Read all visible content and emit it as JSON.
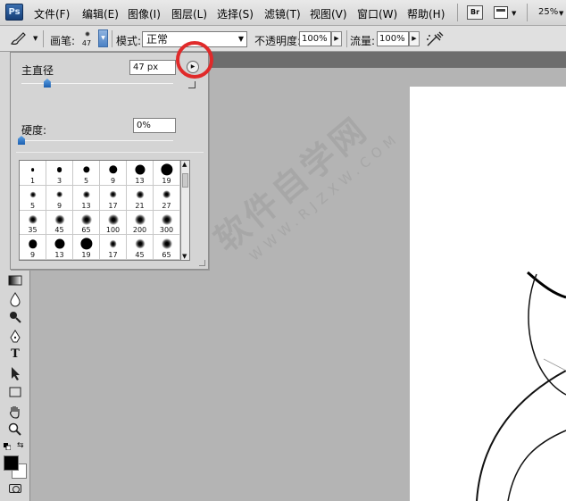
{
  "menubar": {
    "logo": "Ps",
    "items": [
      "文件(F)",
      "编辑(E)",
      "图像(I)",
      "图层(L)",
      "选择(S)",
      "滤镜(T)",
      "视图(V)",
      "窗口(W)",
      "帮助(H)"
    ],
    "bridge_label": "Br",
    "zoom": "25%"
  },
  "options": {
    "brush_label": "画笔:",
    "brush_size": "47",
    "mode_label": "模式:",
    "mode_value": "正常",
    "opacity_label": "不透明度:",
    "opacity_value": "100%",
    "flow_label": "流量:",
    "flow_value": "100%"
  },
  "brush_popup": {
    "diameter_label": "主直径",
    "diameter_value": "47 px",
    "diameter_level_percent": 17,
    "hardness_label": "硬度:",
    "hardness_value": "0%",
    "hardness_level_percent": 0,
    "presets": [
      {
        "size": "1",
        "soft": false
      },
      {
        "size": "3",
        "soft": false
      },
      {
        "size": "5",
        "soft": false
      },
      {
        "size": "9",
        "soft": false
      },
      {
        "size": "13",
        "soft": false
      },
      {
        "size": "19",
        "soft": false
      },
      {
        "size": "5",
        "soft": true
      },
      {
        "size": "9",
        "soft": true
      },
      {
        "size": "13",
        "soft": true
      },
      {
        "size": "17",
        "soft": true
      },
      {
        "size": "21",
        "soft": true
      },
      {
        "size": "27",
        "soft": true
      },
      {
        "size": "35",
        "soft": true
      },
      {
        "size": "45",
        "soft": true
      },
      {
        "size": "65",
        "soft": true
      },
      {
        "size": "100",
        "soft": true
      },
      {
        "size": "200",
        "soft": true
      },
      {
        "size": "300",
        "soft": true
      },
      {
        "size": "9",
        "soft": false
      },
      {
        "size": "13",
        "soft": false
      },
      {
        "size": "19",
        "soft": false
      },
      {
        "size": "17",
        "soft": true
      },
      {
        "size": "45",
        "soft": true
      },
      {
        "size": "65",
        "soft": true
      }
    ]
  },
  "tools": {
    "type_tool_glyph": "T"
  },
  "colors": {
    "foreground": "#000000",
    "background": "#ffffff",
    "highlight": "#e02a2a"
  },
  "watermark": {
    "main": "软件自学网",
    "sub": "WWW.RJZXW.COM"
  }
}
